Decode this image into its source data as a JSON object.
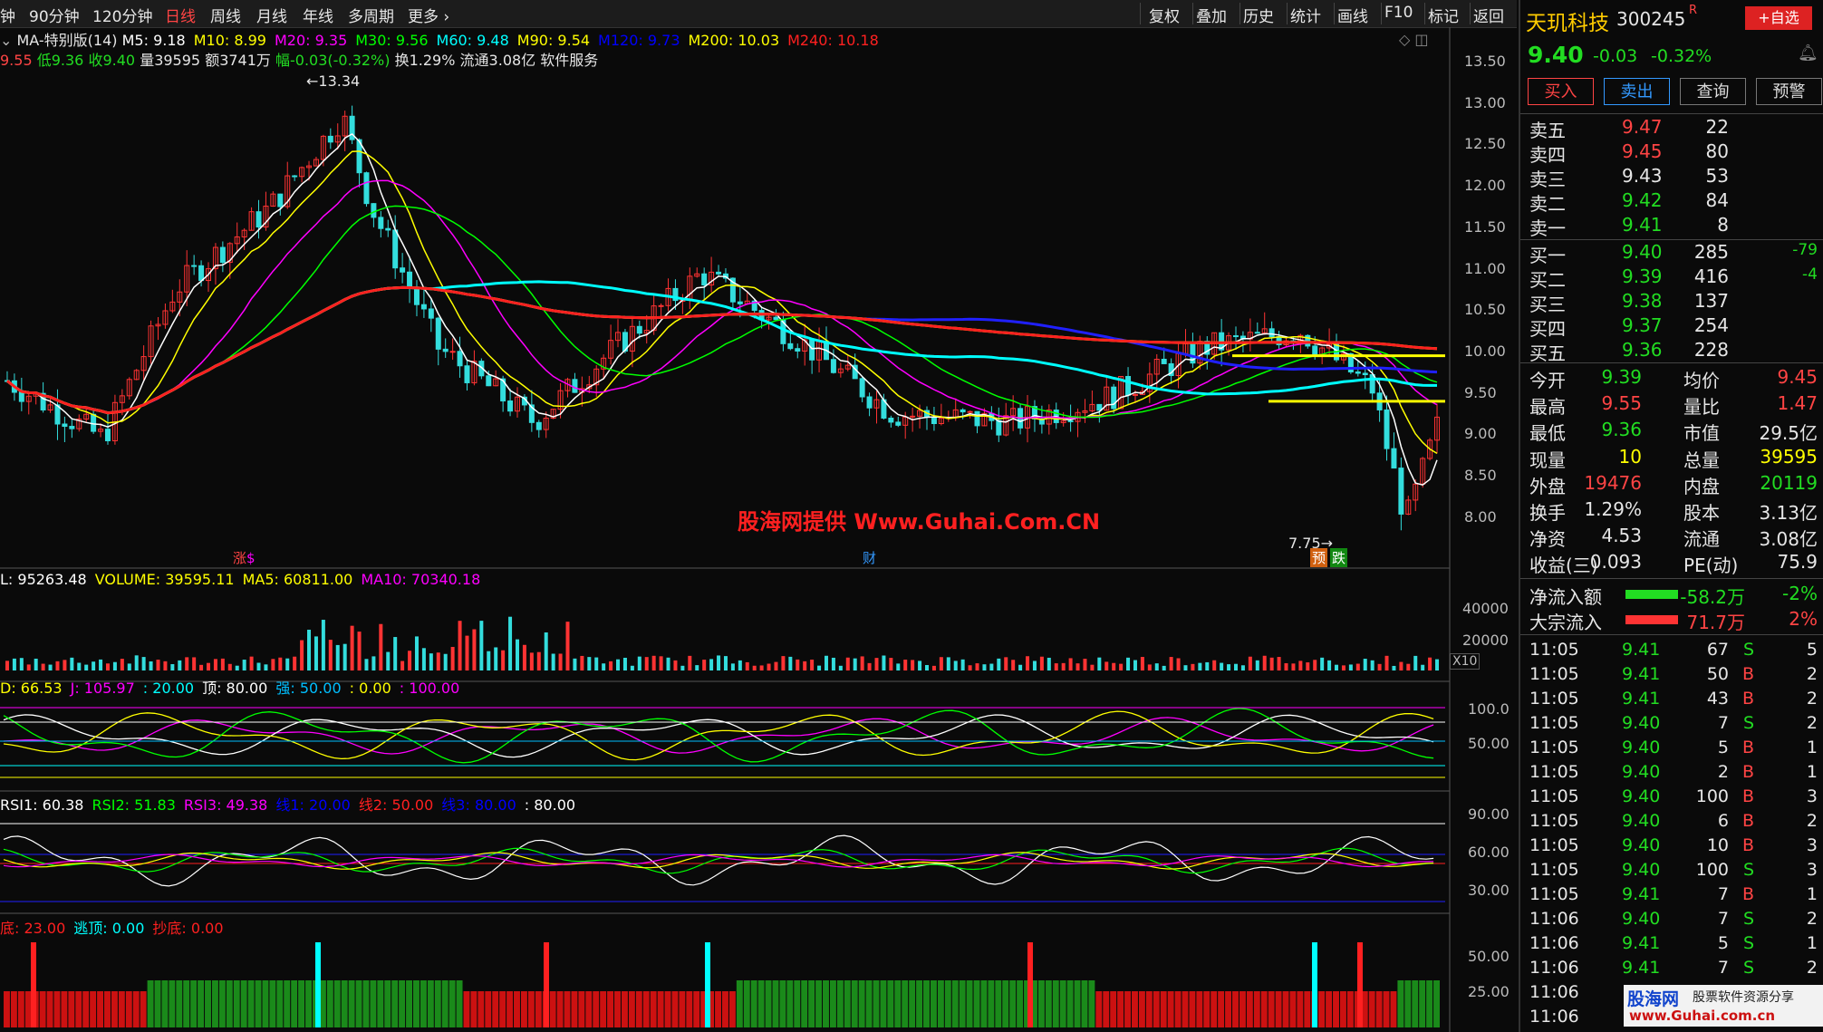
{
  "topbar": {
    "periods": [
      "钟",
      "90分钟",
      "120分钟",
      "日线",
      "周线",
      "月线",
      "年线",
      "多周期",
      "更多"
    ],
    "active": "日线",
    "tools": [
      "复权",
      "叠加",
      "历史",
      "统计",
      "画线",
      "F10",
      "标记",
      "返回"
    ]
  },
  "ma_line": {
    "name": "MA-特别版(14)",
    "items": [
      {
        "label": "M5: 9.18",
        "color": "#ffffff"
      },
      {
        "label": "M10: 8.99",
        "color": "#ffff00"
      },
      {
        "label": "M20: 9.35",
        "color": "#ff00ff"
      },
      {
        "label": "M30: 9.56",
        "color": "#00ff00"
      },
      {
        "label": "M60: 9.48",
        "color": "#00ffff"
      },
      {
        "label": "M90: 9.54",
        "color": "#ffff00"
      },
      {
        "label": "M120: 9.73",
        "color": "#0000ff"
      },
      {
        "label": "M200: 10.03",
        "color": "#ffff00"
      },
      {
        "label": "M240: 10.18",
        "color": "#ff2020"
      }
    ]
  },
  "info_line": {
    "open": "9.55",
    "low": "低9.36",
    "close": "收9.40",
    "volume": "量39595",
    "amount": "额3741万",
    "change": "幅-0.03(-0.32%)",
    "turnover": "换1.29%",
    "float": "流通3.08亿",
    "sector": "软件服务"
  },
  "price_axis": [
    "13.50",
    "13.00",
    "12.50",
    "12.00",
    "11.50",
    "11.00",
    "10.50",
    "10.00",
    "9.50",
    "9.00",
    "8.50",
    "8.00"
  ],
  "annotations": {
    "high": "13.34",
    "low": "7.75",
    "zhang": "涨",
    "cai": "财",
    "yu": "预",
    "die": "跌"
  },
  "watermark": "股海网提供 Www.Guhai.Com.CN",
  "volume_panel": {
    "items": [
      {
        "label": "L: 95263.48",
        "color": "#ffffff"
      },
      {
        "label": "VOLUME: 39595.11",
        "color": "#ffff00"
      },
      {
        "label": "MA5: 60811.00",
        "color": "#ffff00"
      },
      {
        "label": "MA10: 70340.18",
        "color": "#ff00ff"
      }
    ],
    "axis": [
      "40000",
      "20000"
    ],
    "unit": "X10"
  },
  "kdj_panel": {
    "items": [
      {
        "label": "D: 66.53",
        "color": "#ffff00"
      },
      {
        "label": "J: 105.97",
        "color": "#ff00ff"
      },
      {
        "label": ": 20.00",
        "color": "#00ffff"
      },
      {
        "label": "顶: 80.00",
        "color": "#ffffff"
      },
      {
        "label": "强: 50.00",
        "color": "#00bfff"
      },
      {
        "label": ": 0.00",
        "color": "#ffff00"
      },
      {
        "label": ": 100.00",
        "color": "#ff00ff"
      }
    ],
    "axis": [
      "100.0",
      "50.00"
    ]
  },
  "rsi_panel": {
    "items": [
      {
        "label": "RSI1: 60.38",
        "color": "#ffffff"
      },
      {
        "label": "RSI2: 51.83",
        "color": "#00ff00"
      },
      {
        "label": "RSI3: 49.38",
        "color": "#ff00ff"
      },
      {
        "label": "线1: 20.00",
        "color": "#0000ff"
      },
      {
        "label": "线2: 50.00",
        "color": "#ff2020"
      },
      {
        "label": "线3: 80.00",
        "color": "#0000ff"
      },
      {
        "label": ": 80.00",
        "color": "#ffffff"
      }
    ],
    "axis": [
      "90.00",
      "60.00",
      "30.00"
    ]
  },
  "top_panel": {
    "items": [
      {
        "label": "底: 23.00",
        "color": "#ff2020"
      },
      {
        "label": "逃顶: 0.00",
        "color": "#00ffff"
      },
      {
        "label": "抄底: 0.00",
        "color": "#ff2020"
      }
    ],
    "axis": [
      "50.00",
      "25.00"
    ]
  },
  "stock": {
    "name": "天玑科技",
    "code": "300245",
    "flag": "R",
    "add_label": "+自选",
    "price": "9.40",
    "chg": "-0.03",
    "pct": "-0.32%"
  },
  "actions": [
    "买入",
    "卖出",
    "查询",
    "预警"
  ],
  "asks": [
    {
      "label": "卖五",
      "price": "9.47",
      "vol": "22",
      "color": "#ff4444"
    },
    {
      "label": "卖四",
      "price": "9.45",
      "vol": "80",
      "color": "#ff4444"
    },
    {
      "label": "卖三",
      "price": "9.43",
      "vol": "53",
      "color": "#e6e6e6"
    },
    {
      "label": "卖二",
      "price": "9.42",
      "vol": "84",
      "color": "#22dd22"
    },
    {
      "label": "卖一",
      "price": "9.41",
      "vol": "8",
      "color": "#22dd22"
    }
  ],
  "bids": [
    {
      "label": "买一",
      "price": "9.40",
      "vol": "285",
      "extra": "-79",
      "color": "#22dd22"
    },
    {
      "label": "买二",
      "price": "9.39",
      "vol": "416",
      "extra": "-4",
      "color": "#22dd22"
    },
    {
      "label": "买三",
      "price": "9.38",
      "vol": "137",
      "extra": "",
      "color": "#22dd22"
    },
    {
      "label": "买四",
      "price": "9.37",
      "vol": "254",
      "extra": "",
      "color": "#22dd22"
    },
    {
      "label": "买五",
      "price": "9.36",
      "vol": "228",
      "extra": "",
      "color": "#22dd22"
    }
  ],
  "stats": [
    {
      "k1": "今开",
      "v1": "9.39",
      "c1": "#22dd22",
      "k2": "均价",
      "v2": "9.45",
      "c2": "#ff4444"
    },
    {
      "k1": "最高",
      "v1": "9.55",
      "c1": "#ff4444",
      "k2": "量比",
      "v2": "1.47",
      "c2": "#ff4444"
    },
    {
      "k1": "最低",
      "v1": "9.36",
      "c1": "#22dd22",
      "k2": "市值",
      "v2": "29.5亿",
      "c2": "#e6e6e6"
    },
    {
      "k1": "现量",
      "v1": "10",
      "c1": "#ffff00",
      "k2": "总量",
      "v2": "39595",
      "c2": "#ffff00"
    },
    {
      "k1": "外盘",
      "v1": "19476",
      "c1": "#ff4444",
      "k2": "内盘",
      "v2": "20119",
      "c2": "#22dd22"
    },
    {
      "k1": "换手",
      "v1": "1.29%",
      "c1": "#e6e6e6",
      "k2": "股本",
      "v2": "3.13亿",
      "c2": "#e6e6e6"
    },
    {
      "k1": "净资",
      "v1": "4.53",
      "c1": "#e6e6e6",
      "k2": "流通",
      "v2": "3.08亿",
      "c2": "#e6e6e6"
    },
    {
      "k1": "收益(三)",
      "v1": "0.093",
      "c1": "#e6e6e6",
      "k2": "PE(动)",
      "v2": "75.9",
      "c2": "#e6e6e6"
    }
  ],
  "flows": [
    {
      "label": "净流入额",
      "value": "-58.2万",
      "pct": "-2%",
      "bar": "#22dd22",
      "vcolor": "#22dd22"
    },
    {
      "label": "大宗流入",
      "value": "71.7万",
      "pct": "2%",
      "bar": "#ff3333",
      "vcolor": "#ff4444"
    }
  ],
  "ticks": [
    {
      "t": "11:05",
      "p": "9.41",
      "v": "67",
      "d": "S",
      "n": "5",
      "pc": "#22dd22"
    },
    {
      "t": "11:05",
      "p": "9.41",
      "v": "50",
      "d": "B",
      "n": "2",
      "pc": "#22dd22"
    },
    {
      "t": "11:05",
      "p": "9.41",
      "v": "43",
      "d": "B",
      "n": "2",
      "pc": "#22dd22"
    },
    {
      "t": "11:05",
      "p": "9.40",
      "v": "7",
      "d": "S",
      "n": "2",
      "pc": "#22dd22"
    },
    {
      "t": "11:05",
      "p": "9.40",
      "v": "5",
      "d": "B",
      "n": "1",
      "pc": "#22dd22"
    },
    {
      "t": "11:05",
      "p": "9.40",
      "v": "2",
      "d": "B",
      "n": "1",
      "pc": "#22dd22"
    },
    {
      "t": "11:05",
      "p": "9.40",
      "v": "100",
      "d": "B",
      "n": "3",
      "pc": "#22dd22"
    },
    {
      "t": "11:05",
      "p": "9.40",
      "v": "6",
      "d": "B",
      "n": "2",
      "pc": "#22dd22"
    },
    {
      "t": "11:05",
      "p": "9.40",
      "v": "10",
      "d": "B",
      "n": "3",
      "pc": "#22dd22"
    },
    {
      "t": "11:05",
      "p": "9.40",
      "v": "100",
      "d": "S",
      "n": "3",
      "pc": "#22dd22"
    },
    {
      "t": "11:05",
      "p": "9.41",
      "v": "7",
      "d": "B",
      "n": "1",
      "pc": "#22dd22"
    },
    {
      "t": "11:06",
      "p": "9.40",
      "v": "7",
      "d": "S",
      "n": "2",
      "pc": "#22dd22"
    },
    {
      "t": "11:06",
      "p": "9.41",
      "v": "5",
      "d": "S",
      "n": "1",
      "pc": "#22dd22"
    },
    {
      "t": "11:06",
      "p": "9.41",
      "v": "7",
      "d": "S",
      "n": "2",
      "pc": "#22dd22"
    },
    {
      "t": "11:06",
      "p": "",
      "v": "",
      "d": "",
      "n": "",
      "pc": "#22dd22"
    },
    {
      "t": "11:06",
      "p": "",
      "v": "",
      "d": "",
      "n": "",
      "pc": "#22dd22"
    }
  ],
  "logo": {
    "name": "股海网",
    "tagline": "股票软件资源分享",
    "url": "www.Guhai.com.cn"
  }
}
